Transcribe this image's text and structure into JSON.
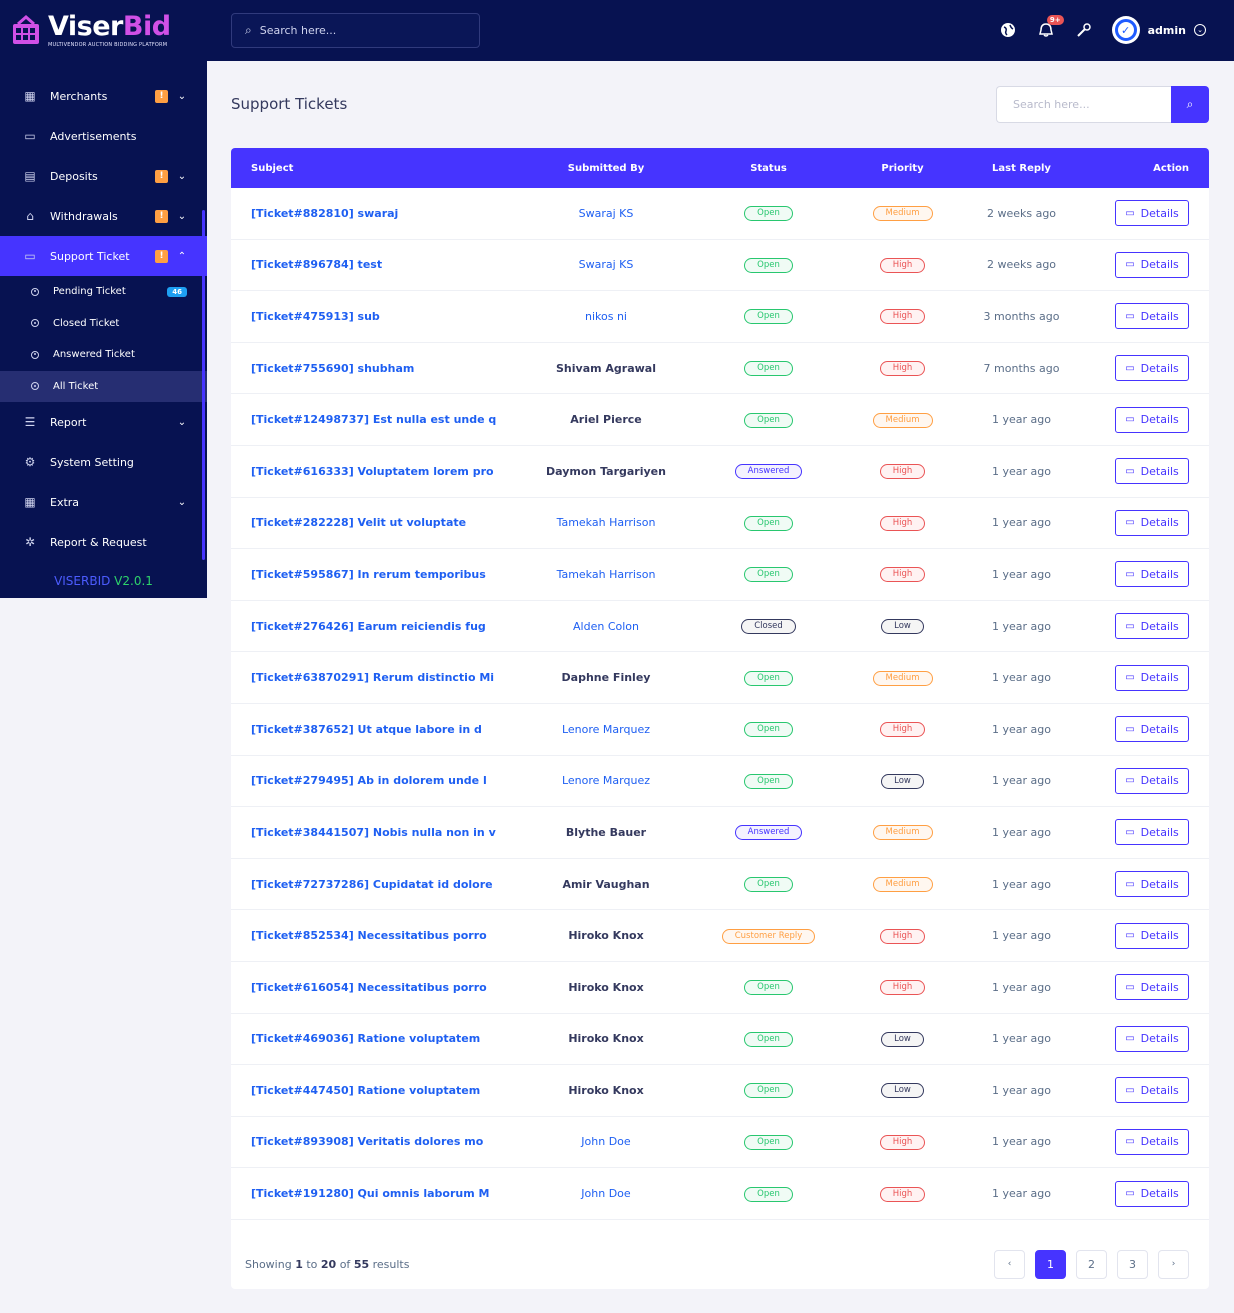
{
  "brand": {
    "name_a": "Viser",
    "name_b": "Bid",
    "tagline": "MULTIVENDOR AUCTION BIDDING PLATFORM",
    "version_a": "VISERBID",
    "version_b": " V2.0.1"
  },
  "topbar": {
    "search_placeholder": "Search here...",
    "notif_badge": "9+",
    "admin_name": "admin",
    "avatar_letter": "✓"
  },
  "sidebar": {
    "items": [
      {
        "label": "Merchants",
        "icon": "▦",
        "warn": "!",
        "chev": "⌄"
      },
      {
        "label": "Advertisements",
        "icon": "▭",
        "warn": "",
        "chev": ""
      },
      {
        "label": "Deposits",
        "icon": "▤",
        "warn": "!",
        "chev": "⌄"
      },
      {
        "label": "Withdrawals",
        "icon": "⌂",
        "warn": "!",
        "chev": "⌄"
      },
      {
        "label": "Support Ticket",
        "icon": "▭",
        "warn": "!",
        "chev": "⌃"
      }
    ],
    "sub_items": [
      {
        "label": "Pending Ticket",
        "badge": "46"
      },
      {
        "label": "Closed Ticket",
        "badge": ""
      },
      {
        "label": "Answered Ticket",
        "badge": ""
      },
      {
        "label": "All Ticket",
        "badge": ""
      }
    ],
    "items2": [
      {
        "label": "Report",
        "icon": "☰",
        "chev": "⌄"
      },
      {
        "label": "System Setting",
        "icon": "⚙",
        "chev": ""
      },
      {
        "label": "Extra",
        "icon": "▦",
        "chev": "⌄"
      },
      {
        "label": "Report & Request",
        "icon": "✲",
        "chev": ""
      }
    ]
  },
  "page": {
    "title": "Support Tickets",
    "search_placeholder": "Search here..."
  },
  "table": {
    "headers": [
      "Subject",
      "Submitted By",
      "Status",
      "Priority",
      "Last Reply",
      "Action"
    ],
    "action_label": "Details",
    "rows": [
      {
        "subject": "[Ticket#882810] swaraj",
        "by": "Swaraj KS",
        "by_style": "link",
        "status": "Open",
        "status_cls": "open",
        "priority": "Medium",
        "priority_cls": "medium",
        "last": "2 weeks ago"
      },
      {
        "subject": "[Ticket#896784] test",
        "by": "Swaraj KS",
        "by_style": "link",
        "status": "Open",
        "status_cls": "open",
        "priority": "High",
        "priority_cls": "high",
        "last": "2 weeks ago"
      },
      {
        "subject": "[Ticket#475913] sub",
        "by": "nikos ni",
        "by_style": "link",
        "status": "Open",
        "status_cls": "open",
        "priority": "High",
        "priority_cls": "high",
        "last": "3 months ago"
      },
      {
        "subject": "[Ticket#755690] shubham",
        "by": "Shivam Agrawal",
        "by_style": "bold",
        "status": "Open",
        "status_cls": "open",
        "priority": "High",
        "priority_cls": "high",
        "last": "7 months ago"
      },
      {
        "subject": "[Ticket#12498737] Est nulla est unde q",
        "by": "Ariel Pierce",
        "by_style": "bold",
        "status": "Open",
        "status_cls": "open",
        "priority": "Medium",
        "priority_cls": "medium",
        "last": "1 year ago"
      },
      {
        "subject": "[Ticket#616333] Voluptatem lorem pro",
        "by": "Daymon Targariyen",
        "by_style": "bold",
        "status": "Answered",
        "status_cls": "answered",
        "priority": "High",
        "priority_cls": "high",
        "last": "1 year ago"
      },
      {
        "subject": "[Ticket#282228] Velit ut voluptate",
        "by": "Tamekah Harrison",
        "by_style": "link",
        "status": "Open",
        "status_cls": "open",
        "priority": "High",
        "priority_cls": "high",
        "last": "1 year ago"
      },
      {
        "subject": "[Ticket#595867] In rerum temporibus",
        "by": "Tamekah Harrison",
        "by_style": "link",
        "status": "Open",
        "status_cls": "open",
        "priority": "High",
        "priority_cls": "high",
        "last": "1 year ago"
      },
      {
        "subject": "[Ticket#276426] Earum reiciendis fug",
        "by": "Alden Colon",
        "by_style": "link",
        "status": "Closed",
        "status_cls": "closed",
        "priority": "Low",
        "priority_cls": "low",
        "last": "1 year ago"
      },
      {
        "subject": "[Ticket#63870291] Rerum distinctio Mi",
        "by": "Daphne Finley",
        "by_style": "bold",
        "status": "Open",
        "status_cls": "open",
        "priority": "Medium",
        "priority_cls": "medium",
        "last": "1 year ago"
      },
      {
        "subject": "[Ticket#387652] Ut atque labore in d",
        "by": "Lenore Marquez",
        "by_style": "link",
        "status": "Open",
        "status_cls": "open",
        "priority": "High",
        "priority_cls": "high",
        "last": "1 year ago"
      },
      {
        "subject": "[Ticket#279495] Ab in dolorem unde l",
        "by": "Lenore Marquez",
        "by_style": "link",
        "status": "Open",
        "status_cls": "open",
        "priority": "Low",
        "priority_cls": "low",
        "last": "1 year ago"
      },
      {
        "subject": "[Ticket#38441507] Nobis nulla non in v",
        "by": "Blythe Bauer",
        "by_style": "bold",
        "status": "Answered",
        "status_cls": "answered",
        "priority": "Medium",
        "priority_cls": "medium",
        "last": "1 year ago"
      },
      {
        "subject": "[Ticket#72737286] Cupidatat id dolore",
        "by": "Amir Vaughan",
        "by_style": "bold",
        "status": "Open",
        "status_cls": "open",
        "priority": "Medium",
        "priority_cls": "medium",
        "last": "1 year ago"
      },
      {
        "subject": "[Ticket#852534] Necessitatibus porro",
        "by": "Hiroko Knox",
        "by_style": "bold",
        "status": "Customer Reply",
        "status_cls": "customer",
        "priority": "High",
        "priority_cls": "high",
        "last": "1 year ago"
      },
      {
        "subject": "[Ticket#616054] Necessitatibus porro",
        "by": "Hiroko Knox",
        "by_style": "bold",
        "status": "Open",
        "status_cls": "open",
        "priority": "High",
        "priority_cls": "high",
        "last": "1 year ago"
      },
      {
        "subject": "[Ticket#469036] Ratione voluptatem",
        "by": "Hiroko Knox",
        "by_style": "bold",
        "status": "Open",
        "status_cls": "open",
        "priority": "Low",
        "priority_cls": "low",
        "last": "1 year ago"
      },
      {
        "subject": "[Ticket#447450] Ratione voluptatem",
        "by": "Hiroko Knox",
        "by_style": "bold",
        "status": "Open",
        "status_cls": "open",
        "priority": "Low",
        "priority_cls": "low",
        "last": "1 year ago"
      },
      {
        "subject": "[Ticket#893908] Veritatis dolores mo",
        "by": "John Doe",
        "by_style": "link",
        "status": "Open",
        "status_cls": "open",
        "priority": "High",
        "priority_cls": "high",
        "last": "1 year ago"
      },
      {
        "subject": "[Ticket#191280] Qui omnis laborum M",
        "by": "John Doe",
        "by_style": "link",
        "status": "Open",
        "status_cls": "open",
        "priority": "High",
        "priority_cls": "high",
        "last": "1 year ago"
      }
    ]
  },
  "pagination": {
    "showing_prefix": "Showing ",
    "from": "1",
    "to_word": " to ",
    "to": "20",
    "of_word": " of ",
    "total": "55",
    "suffix": " results",
    "prev": "‹",
    "next": "›",
    "pages": [
      "1",
      "2",
      "3"
    ],
    "current": "1"
  },
  "colors": {
    "sidebar_bg": "#071251",
    "accent": "#4634ff",
    "link": "#1e5ff2",
    "warn": "#ff9f43"
  }
}
